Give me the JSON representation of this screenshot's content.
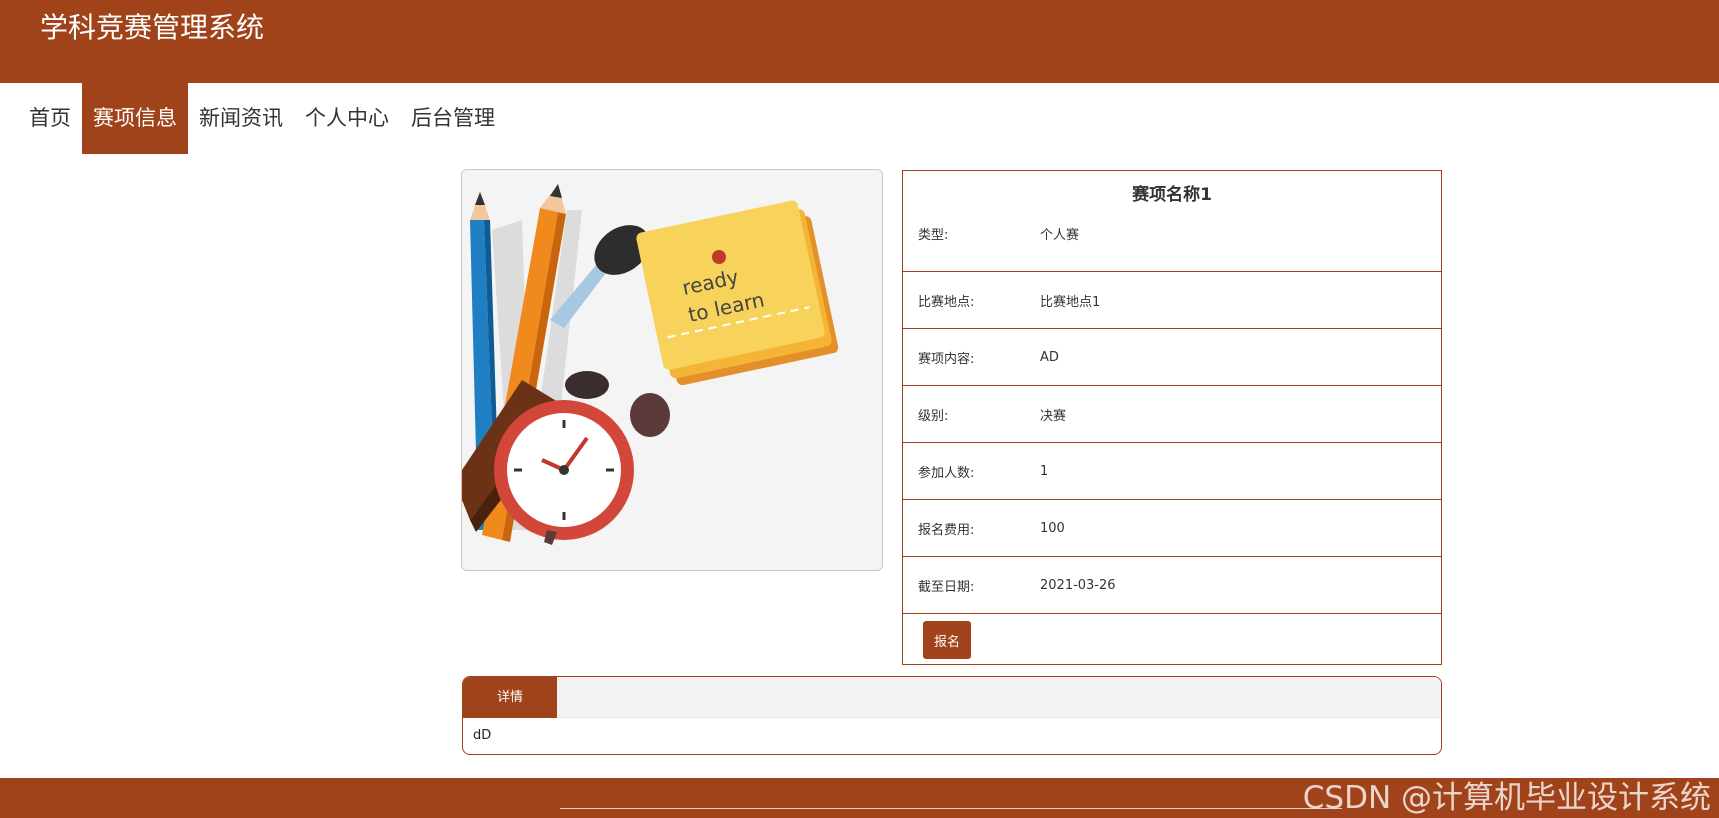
{
  "header": {
    "title": "学科竞赛管理系统"
  },
  "nav": {
    "home": "首页",
    "events": "赛项信息",
    "news": "新闻资讯",
    "personal": "个人中心",
    "admin": "后台管理",
    "active": "赛项信息"
  },
  "image": {
    "note_line1": "ready",
    "note_line2": "to learn"
  },
  "detail": {
    "title": "赛项名称1",
    "rows": [
      {
        "label": "类型:",
        "value": "个人赛"
      },
      {
        "label": "比赛地点:",
        "value": "比赛地点1"
      },
      {
        "label": "赛项内容:",
        "value": "AD"
      },
      {
        "label": "级别:",
        "value": "决赛"
      },
      {
        "label": "参加人数:",
        "value": "1"
      },
      {
        "label": "报名费用:",
        "value": "100"
      },
      {
        "label": "截至日期:",
        "value": "2021-03-26"
      }
    ],
    "signup_label": "报名"
  },
  "tabs": {
    "active_label": "详情",
    "content": "dD"
  },
  "footer": {
    "watermark": "CSDN @计算机毕业设计系统"
  },
  "colors": {
    "brand": "#a0431a",
    "background": "#ffffff"
  }
}
